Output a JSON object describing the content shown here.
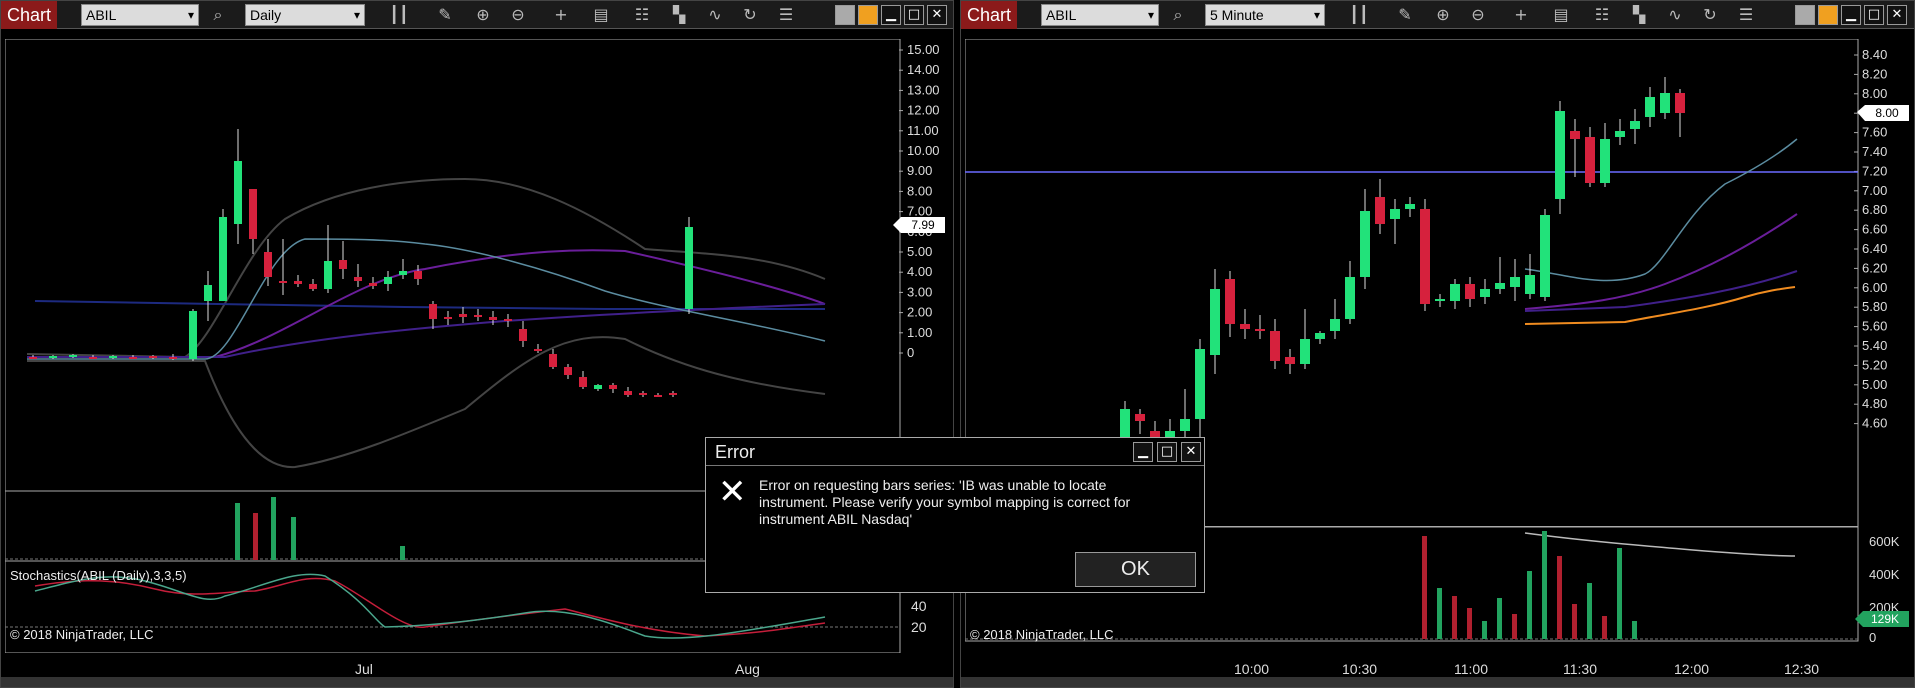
{
  "left": {
    "tab": "Chart",
    "instrument": "ABIL",
    "interval": "Daily",
    "price_label": "7.99",
    "y_ticks": [
      "15.00",
      "14.00",
      "13.00",
      "12.00",
      "11.00",
      "10.00",
      "9.00",
      "8.00",
      "7.00",
      "6.00",
      "5.00",
      "4.00",
      "3.00",
      "2.00",
      "1.00",
      "0"
    ],
    "stoch_ticks": [
      "40",
      "20"
    ],
    "x_ticks": [
      "Jul",
      "Aug"
    ],
    "indicator_label": "Stochastics(ABIL (Daily),3,3,5)",
    "copyright": "© 2018 NinjaTrader, LLC"
  },
  "right": {
    "tab": "Chart",
    "instrument": "ABIL",
    "interval": "5 Minute",
    "price_label": "8.00",
    "vol_label": "129K",
    "y_ticks": [
      "8.40",
      "8.20",
      "8.00",
      "7.80",
      "7.60",
      "7.40",
      "7.20",
      "7.00",
      "6.80",
      "6.60",
      "6.40",
      "6.20",
      "6.00",
      "5.80",
      "5.60",
      "5.40",
      "5.20",
      "5.00",
      "4.80",
      "4.60"
    ],
    "vol_ticks": [
      "600K",
      "400K",
      "200K",
      "0"
    ],
    "x_ticks": [
      "10:00",
      "10:30",
      "11:00",
      "11:30",
      "12:00",
      "12:30"
    ],
    "copyright": "© 2018 NinjaTrader, LLC"
  },
  "dialog": {
    "title": "Error",
    "message": "Error on requesting bars series: 'IB was unable to locate instrument. Please verify your symbol mapping is correct for instrument ABIL Nasdaq'",
    "ok": "OK"
  },
  "icons": {
    "arrow": "▾",
    "search": "⌕",
    "bars": "┃┃",
    "pencil": "✎",
    "zoom_in": "⊕",
    "zoom_out": "⊖",
    "crosshair": "+",
    "data_box": "▤",
    "strategy": "☷",
    "drawing": "▚",
    "indicator": "∿",
    "reload": "↻",
    "properties": "☰",
    "close": "✕",
    "minimize": "▁",
    "maximize": "□"
  },
  "colors": {
    "up": "#22e27a",
    "down": "#d6213d",
    "tab": "#8b1a1a"
  }
}
